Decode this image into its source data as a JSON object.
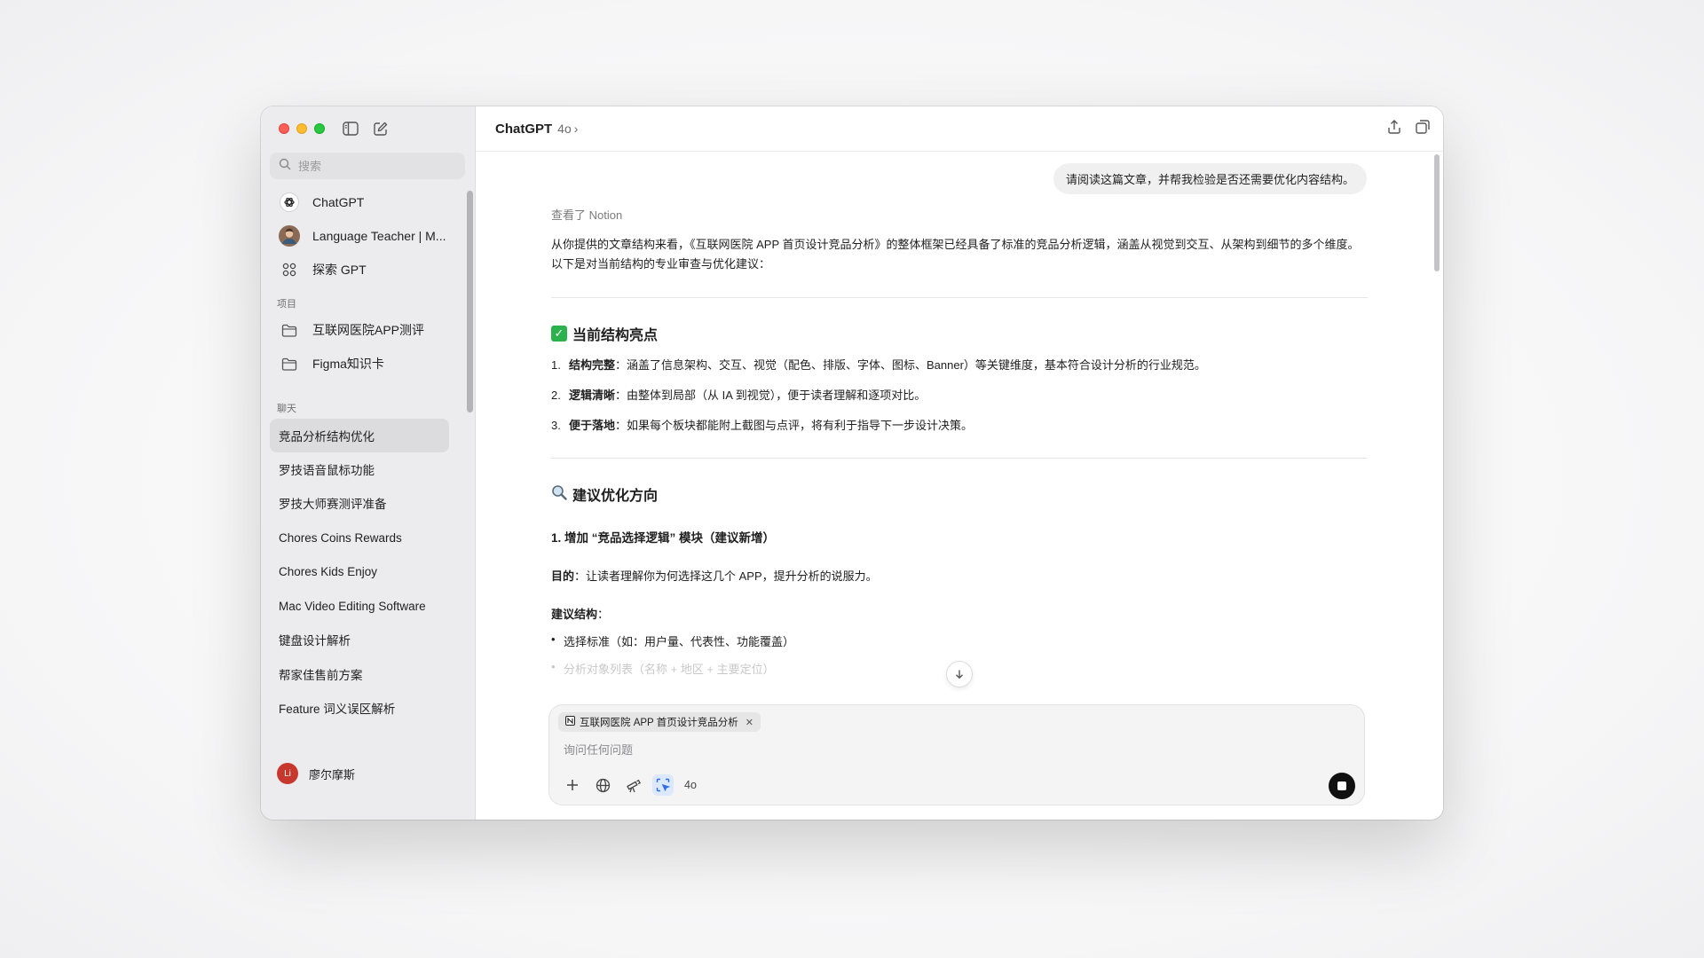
{
  "window": {
    "title": "ChatGPT",
    "model": "4o"
  },
  "sidebar": {
    "search_placeholder": "搜索",
    "top_items": [
      {
        "label": "ChatGPT",
        "icon": "openai-icon"
      },
      {
        "label": "Language Teacher | M...",
        "icon": "gpt-avatar-icon"
      },
      {
        "label": "探索 GPT",
        "icon": "grid-icon"
      }
    ],
    "projects_label": "项目",
    "projects": [
      {
        "label": "互联网医院APP测评"
      },
      {
        "label": "Figma知识卡"
      }
    ],
    "chats_label": "聊天",
    "chats": [
      "竞品分析结构优化",
      "罗技语音鼠标功能",
      "罗技大师赛测评准备",
      "Chores Coins Rewards",
      "Chores Kids Enjoy",
      "Mac Video Editing Software",
      "键盘设计解析",
      "帮家佳售前方案",
      "Feature 词义误区解析"
    ],
    "user": {
      "initials": "Li",
      "name": "廖尔摩斯"
    }
  },
  "conversation": {
    "user_message": "请阅读这篇文章，并帮我检验是否还需要优化内容结构。",
    "tool_note": "查看了 Notion",
    "intro": "从你提供的文章结构来看，《互联网医院 APP 首页设计竞品分析》的整体框架已经具备了标准的竞品分析逻辑，涵盖从视觉到交互、从架构到细节的多个维度。以下是对当前结构的专业审查与优化建议：",
    "section1_title": "当前结构亮点",
    "highlights": [
      {
        "num": "1.",
        "bold": "结构完整",
        "text": "：涵盖了信息架构、交互、视觉（配色、排版、字体、图标、Banner）等关键维度，基本符合设计分析的行业规范。"
      },
      {
        "num": "2.",
        "bold": "逻辑清晰",
        "text": "：由整体到局部（从 IA 到视觉），便于读者理解和逐项对比。"
      },
      {
        "num": "3.",
        "bold": "便于落地",
        "text": "：如果每个板块都能附上截图与点评，将有利于指导下一步设计决策。"
      }
    ],
    "section2_title": "建议优化方向",
    "sub1_title": "1. 增加 “竞品选择逻辑” 模块（建议新增）",
    "purpose_label": "目的",
    "purpose_text": "：让读者理解你为何选择这几个 APP，提升分析的说服力。",
    "structure_label": "建议结构",
    "structure_colon": "：",
    "bullets": [
      "选择标准（如：用户量、代表性、功能覆盖）",
      "分析对象列表（名称 + 地区 + 主要定位）"
    ]
  },
  "composer": {
    "attachment": "互联网医院 APP 首页设计竞品分析",
    "placeholder": "询问任何问题",
    "model_chip": "4o"
  }
}
